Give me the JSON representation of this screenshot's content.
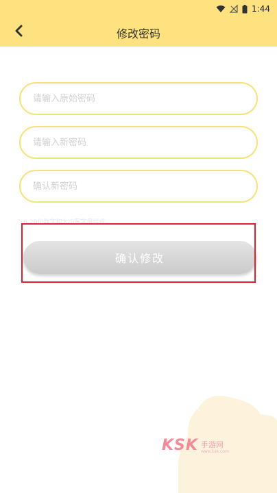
{
  "status_bar": {
    "time": "1:44"
  },
  "header": {
    "title": "修改密码"
  },
  "form": {
    "old_password_placeholder": "请输入原始密码",
    "new_password_placeholder": "请输入新密码",
    "confirm_password_placeholder": "确认新密码",
    "hint": "6-20位数字和大小写字母组成",
    "submit_label": "确认修改"
  },
  "watermark": {
    "brand": "KSK",
    "sub": "手游网",
    "url": "www.ksk.com"
  },
  "colors": {
    "header_bg": "#fde27f",
    "input_border": "#f4e27a",
    "button_bg": "#d6d6d6",
    "highlight": "#e0202a"
  },
  "icons": {
    "back": "chevron-left-icon",
    "wifi": "wifi-icon",
    "signal": "no-signal-icon",
    "battery": "battery-icon"
  }
}
